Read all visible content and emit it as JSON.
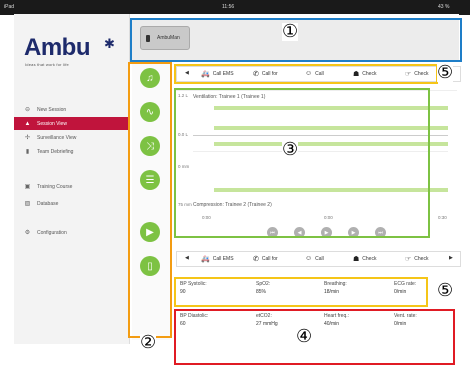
{
  "status": {
    "carrier": "iPad",
    "time": "11:56",
    "battery": "43 %"
  },
  "sidebar": {
    "logo": "Ambu",
    "tagline": "Ideas that work for life",
    "items": [
      {
        "label": "New Session",
        "icon": "new-session-icon",
        "active": false
      },
      {
        "label": "Session View",
        "icon": "session-view-icon",
        "active": true
      },
      {
        "label": "Surveillance View",
        "icon": "surveillance-icon",
        "active": false
      },
      {
        "label": "Team Debriefing",
        "icon": "debriefing-icon",
        "active": false
      },
      {
        "label": "Training Course",
        "icon": "training-course-icon",
        "active": false
      },
      {
        "label": "Database",
        "icon": "database-icon",
        "active": false
      },
      {
        "label": "Configuration",
        "icon": "configuration-icon",
        "active": false
      }
    ]
  },
  "device": {
    "name": "AmbuMan"
  },
  "toolbar": {
    "prev": "◀",
    "next": "▶",
    "top_items": [
      "Call EMS",
      "Call for",
      "Call",
      "Check",
      "Check"
    ],
    "bottom_items": [
      "Call EMS",
      "Call for",
      "Call",
      "Check",
      "Check"
    ]
  },
  "chart": {
    "ventilation_title": "Ventilation: Trainee 1 (Trainee 1)",
    "compression_title": "Compression: Trainee 2 (Trainee 2)",
    "y_labels": [
      "1.2 L",
      "0.0 L",
      "0 mm",
      "75 mm"
    ],
    "x_labels": [
      "0:00",
      "0:00",
      "0:30"
    ]
  },
  "vitals": {
    "row1": [
      {
        "label": "BP Systolic:",
        "value": "90"
      },
      {
        "label": "SpO2:",
        "value": "85%"
      },
      {
        "label": "Breathing:",
        "value": "18/min"
      },
      {
        "label": "ECG rate:",
        "value": "0/min"
      }
    ],
    "row2": [
      {
        "label": "BP Diastolic:",
        "value": "60"
      },
      {
        "label": "etCO2:",
        "value": "27 mmHg"
      },
      {
        "label": "Heart freq.:",
        "value": "40/min"
      },
      {
        "label": "Vent. rate:",
        "value": "0/min"
      }
    ]
  },
  "annotations": [
    "①",
    "②",
    "③",
    "④",
    "⑤",
    "⑤"
  ],
  "colors": {
    "accent_green": "#7dc243",
    "active_red": "#c0143c",
    "frame_blue": "#1e7ec8",
    "frame_orange": "#f39c12",
    "frame_green": "#7dc243",
    "frame_red": "#e01b24",
    "frame_yellow": "#f5c518"
  }
}
